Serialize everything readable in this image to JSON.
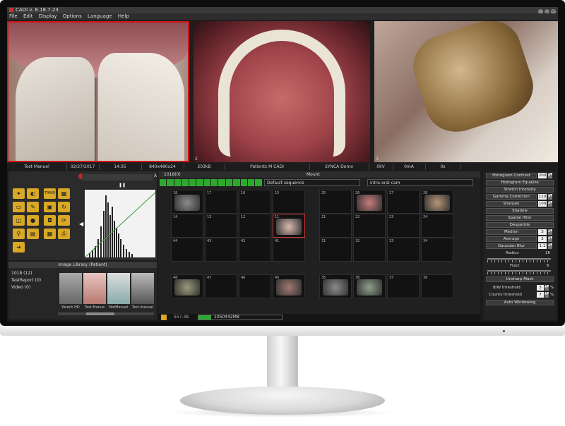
{
  "titlebar": {
    "title": "CADI v. 8.18.7.23",
    "buttons": [
      "-",
      "□",
      "×"
    ]
  },
  "menu": {
    "items": [
      "File",
      "Edit",
      "Display",
      "Options",
      "Language",
      "Help"
    ]
  },
  "viewer": {
    "panel_numbers": [
      "2",
      "3"
    ]
  },
  "status": {
    "name": "Test Manuel",
    "date": "02/27/2017",
    "time": "14:35",
    "resolution": "840x480x24",
    "size": "203kB",
    "patient": "Patients M CADI",
    "source": "SYNCA Demo",
    "kv": "0kV",
    "ma": "0mA",
    "seconds": "0s"
  },
  "histogram": {
    "label": "A",
    "pause": "❚❚",
    "arrow": "◀"
  },
  "tools": {
    "icons": [
      "wand-icon",
      "fade-icon",
      "train-icon",
      "grid-2-icon",
      "folder-icon",
      "pencil-icon",
      "save-icon",
      "refresh-icon",
      "folder-open-icon",
      "color-icon",
      "disk-icon",
      "sync-icon",
      "zoom-icon",
      "select-icon",
      "grid-icon",
      "print-icon",
      "exit-icon"
    ],
    "train_label": "TRAIN"
  },
  "library": {
    "title": "Image Library (Patient)",
    "tree": [
      "1018 (12)",
      "TestReport (0)",
      "Video (0)"
    ],
    "thumbs": [
      "Yatech HD",
      "Test Manue",
      "NotManuel",
      "Test manual"
    ]
  },
  "mount": {
    "id": "1018(0)",
    "title": "Mount",
    "sequence": "Default sequence",
    "camera": "intra-oral cam",
    "row1": [
      "18",
      "17",
      "16",
      "15",
      "25",
      "26",
      "27",
      "28"
    ],
    "row2": [
      "14",
      "13",
      "12",
      "11",
      "21",
      "22",
      "23",
      "24"
    ],
    "row3": [
      "44",
      "43",
      "42",
      "41",
      "31",
      "32",
      "33",
      "34"
    ],
    "row4": [
      "48",
      "47",
      "46",
      "45",
      "35",
      "36",
      "37",
      "38"
    ]
  },
  "bottom": {
    "counter": "557.3B",
    "memory": "1050442MB"
  },
  "tools_right": {
    "histogram_contrast": "Histogram Contrast",
    "histogram_contrast_val": "200",
    "histogram_equalize": "Histogram Equalize",
    "stretch_intensity": "Stretch Intensity",
    "gamma": "Gamma Correction",
    "gamma_val": "110",
    "sharpen": "Sharpen",
    "sharpen_val": "100",
    "shadow": "Shadow",
    "spatial": "Spatial filter",
    "despeckle": "Despeckle",
    "median": "Median",
    "median_val": "3",
    "average": "Average",
    "average_val": "2",
    "gaussian": "Gaussian Blur",
    "gaussian_val": "1.1",
    "radius": "Radius",
    "radius_val": "16",
    "fract": "Fract",
    "fract_val": "6",
    "unsharp": "Unsharp Mask",
    "bw": "B/W threshold",
    "bw_val": "3",
    "counts": "Counts threshold",
    "counts_val": "7",
    "percent": "%",
    "auto": "Auto Windowing"
  },
  "colors": {
    "accent_red": "#d01515",
    "tool_yellow": "#d9a824",
    "progress_green": "#2fa82f"
  }
}
